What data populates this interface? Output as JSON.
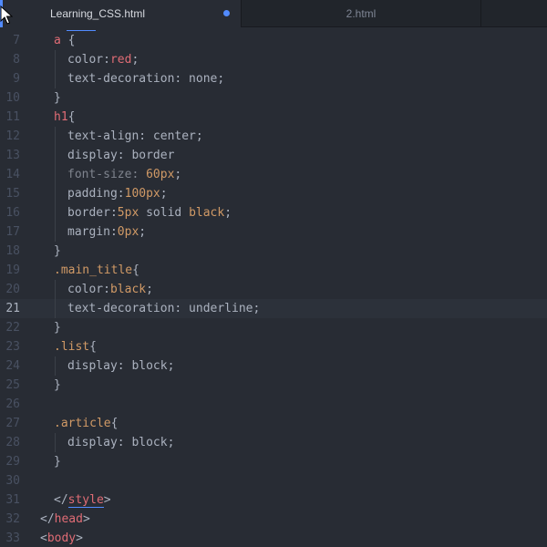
{
  "tabs": [
    {
      "label": "Learning_CSS.html",
      "active": true,
      "modified": true
    },
    {
      "label": "2.html",
      "active": false,
      "modified": false
    }
  ],
  "colors": {
    "background": "#282c34",
    "tab_bar": "#21252b",
    "accent": "#528bff",
    "tag": "#e06c75",
    "value": "#d19a66",
    "text": "#abb2bf",
    "gutter": "#495162"
  },
  "current_line": 21,
  "lines": [
    {
      "num": "7",
      "indent": 1,
      "tokens": [
        {
          "t": "a",
          "c": "tag"
        },
        {
          "t": " {",
          "c": "punct"
        }
      ]
    },
    {
      "num": "8",
      "indent": 2,
      "tokens": [
        {
          "t": "color:",
          "c": "prop"
        },
        {
          "t": "red",
          "c": "tag"
        },
        {
          "t": ";",
          "c": "punct"
        }
      ]
    },
    {
      "num": "9",
      "indent": 2,
      "tokens": [
        {
          "t": "text-decoration: none;",
          "c": "prop"
        }
      ]
    },
    {
      "num": "10",
      "indent": 1,
      "tokens": [
        {
          "t": "}",
          "c": "punct"
        }
      ]
    },
    {
      "num": "11",
      "indent": 1,
      "tokens": [
        {
          "t": "h1",
          "c": "tag"
        },
        {
          "t": "{",
          "c": "punct"
        }
      ]
    },
    {
      "num": "12",
      "indent": 2,
      "tokens": [
        {
          "t": "text-align: center;",
          "c": "prop"
        }
      ]
    },
    {
      "num": "13",
      "indent": 2,
      "tokens": [
        {
          "t": "display: border",
          "c": "prop"
        }
      ]
    },
    {
      "num": "14",
      "indent": 2,
      "tokens": [
        {
          "t": "font-size: ",
          "c": "comment"
        },
        {
          "t": "60px",
          "c": "val"
        },
        {
          "t": ";",
          "c": "punct"
        }
      ]
    },
    {
      "num": "15",
      "indent": 2,
      "tokens": [
        {
          "t": "padding:",
          "c": "prop"
        },
        {
          "t": "100px",
          "c": "val"
        },
        {
          "t": ";",
          "c": "punct"
        }
      ]
    },
    {
      "num": "16",
      "indent": 2,
      "tokens": [
        {
          "t": "border:",
          "c": "prop"
        },
        {
          "t": "5px",
          "c": "val"
        },
        {
          "t": " solid ",
          "c": "plain"
        },
        {
          "t": "black",
          "c": "val"
        },
        {
          "t": ";",
          "c": "punct"
        }
      ]
    },
    {
      "num": "17",
      "indent": 2,
      "tokens": [
        {
          "t": "margin:",
          "c": "prop"
        },
        {
          "t": "0px",
          "c": "val"
        },
        {
          "t": ";",
          "c": "punct"
        }
      ]
    },
    {
      "num": "18",
      "indent": 1,
      "tokens": [
        {
          "t": "}",
          "c": "punct"
        }
      ]
    },
    {
      "num": "19",
      "indent": 1,
      "tokens": [
        {
          "t": ".main_title",
          "c": "sel"
        },
        {
          "t": "{",
          "c": "punct"
        }
      ]
    },
    {
      "num": "20",
      "indent": 2,
      "tokens": [
        {
          "t": "color:",
          "c": "prop"
        },
        {
          "t": "black",
          "c": "val"
        },
        {
          "t": ";",
          "c": "punct"
        }
      ]
    },
    {
      "num": "21",
      "indent": 2,
      "tokens": [
        {
          "t": "text-decoration: underline;",
          "c": "prop"
        }
      ]
    },
    {
      "num": "22",
      "indent": 1,
      "tokens": [
        {
          "t": "}",
          "c": "punct"
        }
      ]
    },
    {
      "num": "23",
      "indent": 1,
      "tokens": [
        {
          "t": ".list",
          "c": "sel"
        },
        {
          "t": "{",
          "c": "punct"
        }
      ]
    },
    {
      "num": "24",
      "indent": 2,
      "tokens": [
        {
          "t": "display: block;",
          "c": "prop"
        }
      ]
    },
    {
      "num": "25",
      "indent": 1,
      "tokens": [
        {
          "t": "}",
          "c": "punct"
        }
      ]
    },
    {
      "num": "26",
      "indent": 0,
      "tokens": []
    },
    {
      "num": "27",
      "indent": 1,
      "tokens": [
        {
          "t": ".article",
          "c": "sel"
        },
        {
          "t": "{",
          "c": "punct"
        }
      ]
    },
    {
      "num": "28",
      "indent": 2,
      "tokens": [
        {
          "t": "display: block;",
          "c": "prop"
        }
      ]
    },
    {
      "num": "29",
      "indent": 1,
      "tokens": [
        {
          "t": "}",
          "c": "punct"
        }
      ]
    },
    {
      "num": "30",
      "indent": 0,
      "tokens": []
    },
    {
      "num": "31",
      "indent": 1,
      "tokens": [
        {
          "t": "</",
          "c": "punct"
        },
        {
          "t": "style",
          "c": "tag",
          "u": true
        },
        {
          "t": ">",
          "c": "punct"
        }
      ]
    },
    {
      "num": "32",
      "indent": 0,
      "tokens": [
        {
          "t": "</",
          "c": "punct"
        },
        {
          "t": "head",
          "c": "tag"
        },
        {
          "t": ">",
          "c": "punct"
        }
      ]
    },
    {
      "num": "33",
      "indent": 0,
      "tokens": [
        {
          "t": "<",
          "c": "punct"
        },
        {
          "t": "body",
          "c": "tag"
        },
        {
          "t": ">",
          "c": "punct"
        }
      ]
    }
  ]
}
